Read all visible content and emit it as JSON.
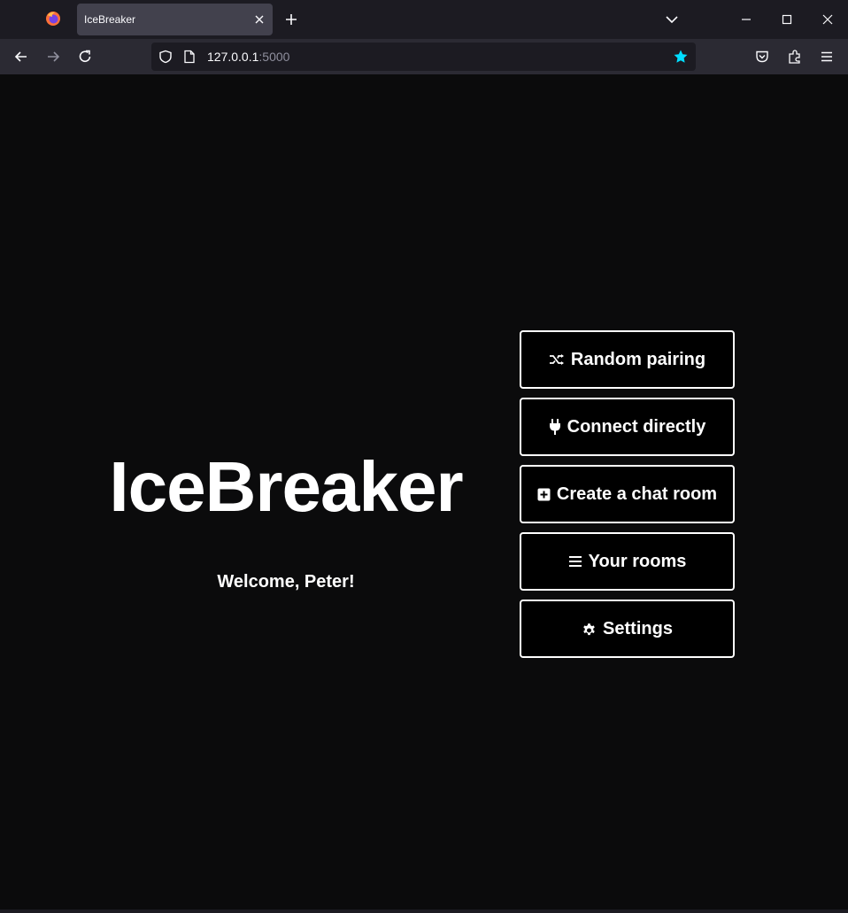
{
  "browser": {
    "tab": {
      "title": "IceBreaker"
    },
    "url": {
      "host": "127.0.0.1",
      "port": ":5000"
    }
  },
  "page": {
    "title": "IceBreaker",
    "welcome": "Welcome, Peter!",
    "buttons": [
      {
        "label": "Random pairing",
        "icon": "shuffle-icon"
      },
      {
        "label": "Connect directly",
        "icon": "plug-icon"
      },
      {
        "label": "Create a chat room",
        "icon": "plus-square-icon"
      },
      {
        "label": "Your rooms",
        "icon": "list-icon"
      },
      {
        "label": "Settings",
        "icon": "gear-icon"
      }
    ]
  },
  "colors": {
    "background": "#0b0b0c",
    "chrome_dark": "#1c1b22",
    "chrome_toolbar": "#2b2a33",
    "bookmark_star": "#00ddff",
    "text": "#ffffff"
  }
}
